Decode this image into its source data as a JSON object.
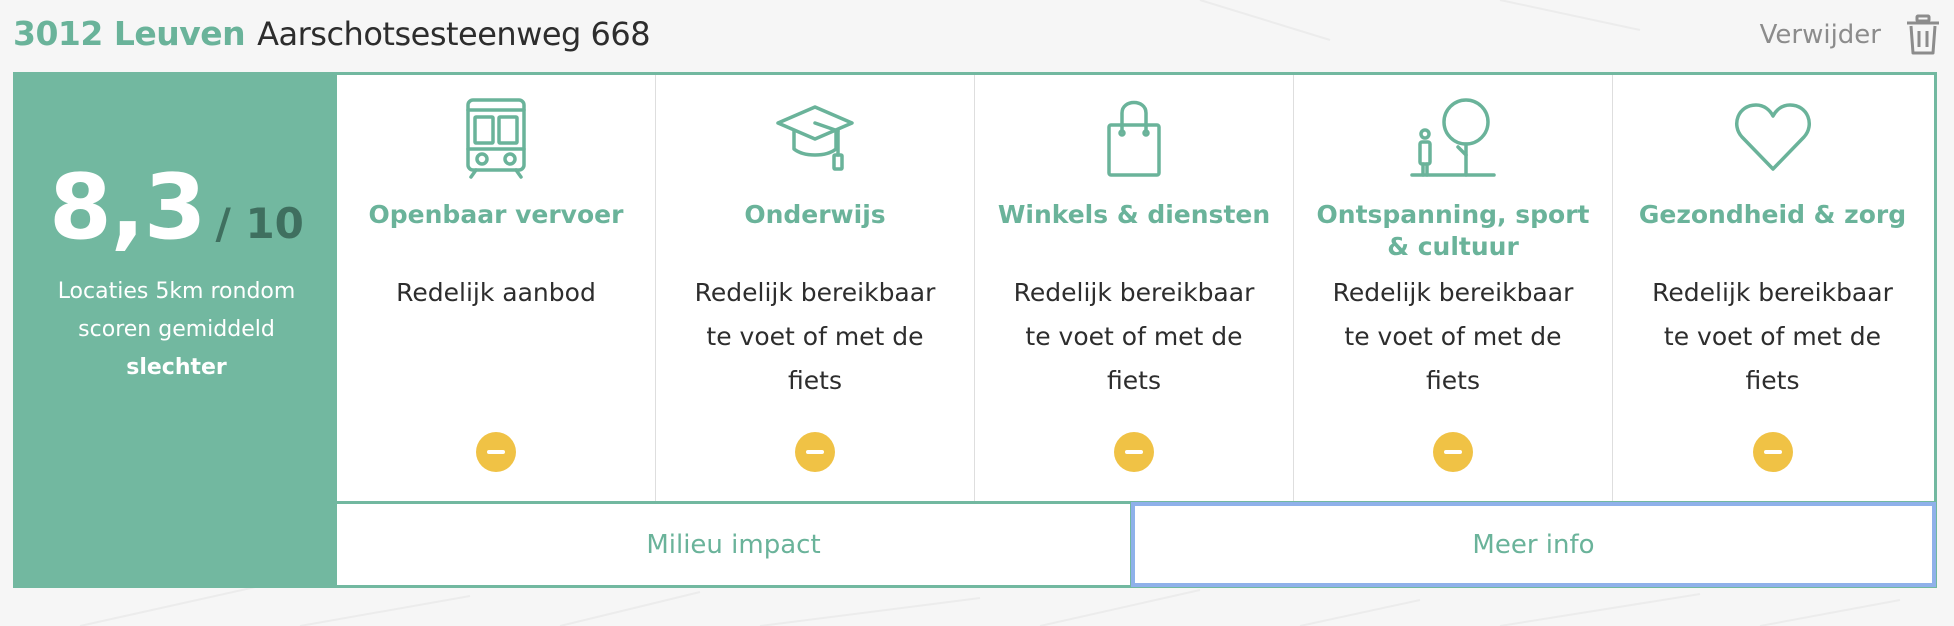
{
  "header": {
    "postal_city": "3012 Leuven",
    "street": "Aarschotsesteenweg 668",
    "delete_label": "Verwijder"
  },
  "score": {
    "value": "8,3",
    "max": "/ 10",
    "note_prefix": "Locaties 5km rondom scoren gemiddeld",
    "note_emphasis": "slechter"
  },
  "categories": [
    {
      "title": "Openbaar vervoer",
      "description": "Redelijk aanbod",
      "icon": "bus-icon",
      "badge": "neutral-minus"
    },
    {
      "title": "Onderwijs",
      "description": "Redelijk bereikbaar te voet of met de fiets",
      "icon": "graduation-cap-icon",
      "badge": "neutral-minus"
    },
    {
      "title": "Winkels & diensten",
      "description": "Redelijk bereikbaar te voet of met de fiets",
      "icon": "shopping-bag-icon",
      "badge": "neutral-minus"
    },
    {
      "title": "Ontspanning, sport & cultuur",
      "description": "Redelijk bereikbaar te voet of met de fiets",
      "icon": "park-tree-icon",
      "badge": "neutral-minus"
    },
    {
      "title": "Gezondheid & zorg",
      "description": "Redelijk bereikbaar te voet of met de fiets",
      "icon": "heart-icon",
      "badge": "neutral-minus"
    }
  ],
  "actions": {
    "milieu_label": "Milieu impact",
    "meer_info_label": "Meer info"
  },
  "colors": {
    "accent": "#72b8a0",
    "accent_text": "#6ab39a",
    "badge": "#f0c245",
    "focus": "#8fb1ea"
  }
}
